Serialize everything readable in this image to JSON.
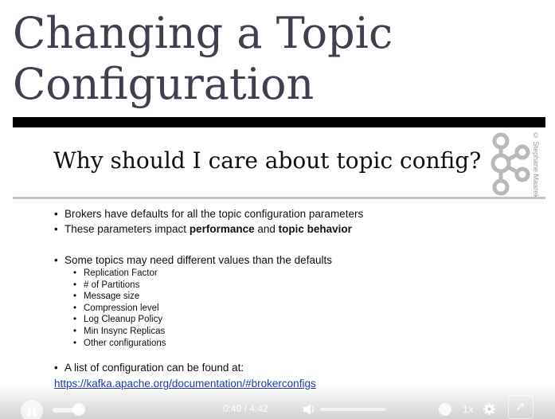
{
  "page": {
    "title_line1": "Changing a Topic",
    "title_line2": "Configuration"
  },
  "slide": {
    "heading": "Why should I care about topic config?",
    "copyright": "© Stephane Maarek",
    "bullet1": "Brokers have defaults for all the topic configuration parameters",
    "bullet2_prefix": "These parameters impact ",
    "bullet2_bold1": "performance",
    "bullet2_middle": " and ",
    "bullet2_bold2": "topic behavior",
    "bullet3": "Some topics may need different values than the defaults",
    "sub_items": [
      "Replication Factor",
      "# of Partitions",
      "Message size",
      "Compression level",
      "Log Cleanup Policy",
      "Min Insync Replicas",
      "Other configurations"
    ],
    "bullet4": "A list of configuration can be found at:",
    "link": "https://kafka.apache.org/documentation/#brokerconfigs"
  },
  "player": {
    "time": "0:49 / 4:42",
    "speed": "1x",
    "progress_fraction": 0.17,
    "volume_fraction": 0.0
  },
  "icons": {
    "logo": "kafka-logo-icon",
    "play": "pause-icon",
    "volume": "volume-icon",
    "captions": "captions-icon",
    "settings": "gear-icon",
    "fullscreen": "fullscreen-icon"
  }
}
